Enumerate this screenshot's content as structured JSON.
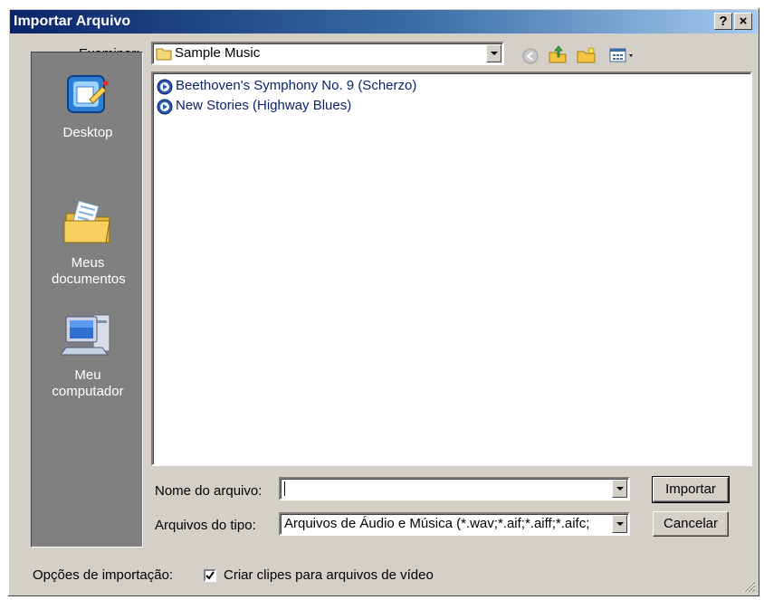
{
  "window": {
    "title": "Importar Arquivo",
    "help_label": "?",
    "close_label": "×"
  },
  "look_in": {
    "label": "Examinar:",
    "value": "Sample Music"
  },
  "toolbar": {
    "icons": [
      "back-icon",
      "up-folder-icon",
      "new-folder-icon",
      "view-menu-icon"
    ]
  },
  "places": [
    {
      "label": "Desktop",
      "icon": "desktop-icon"
    },
    {
      "label": "Meus documentos",
      "icon": "my-documents-icon"
    },
    {
      "label": "Meu computador",
      "icon": "my-computer-icon"
    }
  ],
  "files": [
    {
      "name": "Beethoven's Symphony No. 9 (Scherzo)",
      "icon": "audio-file-icon"
    },
    {
      "name": "New Stories (Highway Blues)",
      "icon": "audio-file-icon"
    }
  ],
  "filename": {
    "label": "Nome do arquivo:",
    "value": ""
  },
  "filetype": {
    "label": "Arquivos do tipo:",
    "value": "Arquivos de Áudio e Música (*.wav;*.aif;*.aiff;*.aifc;"
  },
  "buttons": {
    "import": "Importar",
    "cancel": "Cancelar"
  },
  "options": {
    "label": "Opções de importação:",
    "checkbox_label": "Criar clipes para arquivos de vídeo",
    "checked": true
  },
  "colors": {
    "title_start": "#0a246a",
    "title_end": "#a6caf0",
    "face": "#d4d0c8",
    "places_bg": "#808080"
  }
}
